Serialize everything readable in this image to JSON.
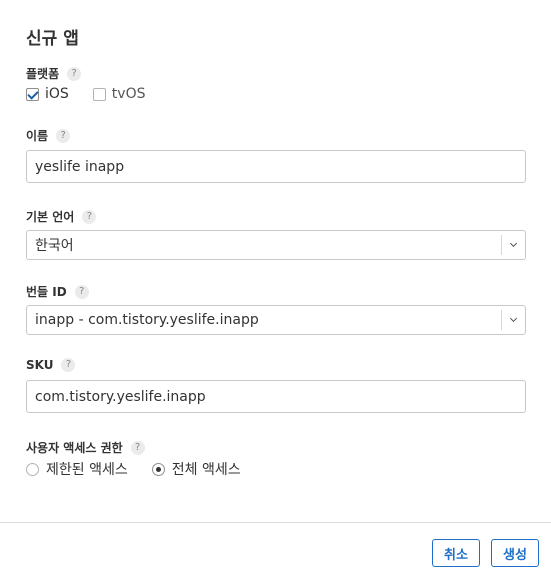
{
  "dialog": {
    "title": "신규 앱"
  },
  "platform": {
    "label": "플랫폼",
    "help": "?",
    "options": [
      {
        "label": "iOS",
        "checked": true
      },
      {
        "label": "tvOS",
        "checked": false
      }
    ]
  },
  "name": {
    "label": "이름",
    "help": "?",
    "value": "yeslife inapp"
  },
  "language": {
    "label": "기본 언어",
    "help": "?",
    "value": "한국어"
  },
  "bundle": {
    "label": "번들 ID",
    "help": "?",
    "value": "inapp - com.tistory.yeslife.inapp"
  },
  "sku": {
    "label": "SKU",
    "help": "?",
    "value": "com.tistory.yeslife.inapp"
  },
  "access": {
    "label": "사용자 액세스 권한",
    "help": "?",
    "options": [
      {
        "label": "제한된 액세스",
        "selected": false
      },
      {
        "label": "전체 액세스",
        "selected": true
      }
    ]
  },
  "footer": {
    "cancel_label": "취소",
    "create_label": "생성"
  },
  "colors": {
    "accent": "#1d6fc9",
    "border": "#c8c8c8",
    "text": "#333333"
  }
}
